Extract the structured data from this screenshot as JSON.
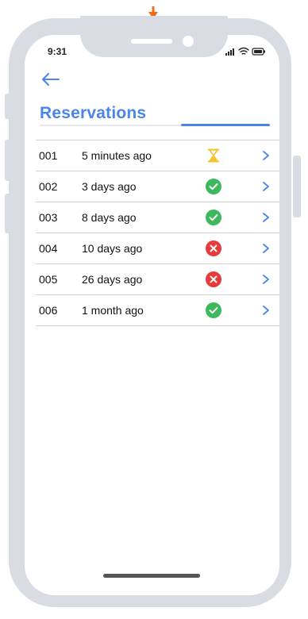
{
  "status_bar": {
    "time": "9:31",
    "icons": [
      "signal-icon",
      "wifi-icon",
      "battery-icon"
    ]
  },
  "header": {
    "back_icon": "back-arrow-icon",
    "title": "Reservations"
  },
  "reservations": [
    {
      "id": "001",
      "time": "5 minutes ago",
      "status": "pending"
    },
    {
      "id": "002",
      "time": "3 days ago",
      "status": "approved"
    },
    {
      "id": "003",
      "time": "8 days ago",
      "status": "approved"
    },
    {
      "id": "004",
      "time": "10 days ago",
      "status": "rejected"
    },
    {
      "id": "005",
      "time": "26 days ago",
      "status": "rejected"
    },
    {
      "id": "006",
      "time": "1 month ago",
      "status": "approved"
    }
  ],
  "colors": {
    "accent": "#4a86e8",
    "pending": "#f4c430",
    "approved": "#3cb95d",
    "rejected": "#e83a3a",
    "top_arrow": "#f26a1b",
    "frame": "#d9dde3"
  }
}
